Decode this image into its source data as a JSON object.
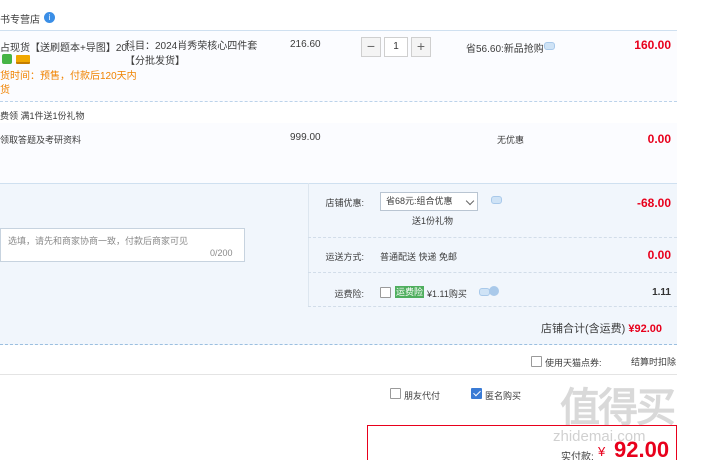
{
  "shop": {
    "name": "书专营店",
    "badge": "i"
  },
  "item1": {
    "title": "占现货【送刷题本+导图】20...",
    "delivery_note": "货时间：预售，付款后120天内",
    "delivery_note2": "货",
    "sku_line1": "科目：2024肖秀荣核心四件套",
    "sku_line2": "【分批发货】",
    "price": "216.60",
    "quantity": "1",
    "minus": "−",
    "plus": "+",
    "save_text": "省56.60:新品抢购",
    "subtotal": "160.00"
  },
  "gift_row": "费领    满1件送1份礼物",
  "item2": {
    "title": "领取答题及考研资料",
    "price": "999.00",
    "discount": "无优惠",
    "subtotal": "0.00"
  },
  "remark": {
    "placeholder": "选填，请先和商家协商一致，付款后商家可见",
    "count": "0/200"
  },
  "summary": {
    "promo_label": "店铺优惠:",
    "promo_value": "省68元:组合优惠",
    "promo_gift": "送1份礼物",
    "promo_amount": "-68.00",
    "shipping_label": "运送方式:",
    "shipping_value": "普通配送 快递 免邮",
    "shipping_amount": "0.00",
    "insurance_label": "运费险:",
    "insurance_badge": "运费险",
    "insurance_value": "¥1.11购买",
    "insurance_amount": "1.11",
    "shop_total_label": "店铺合计(含运费)",
    "shop_total_value": "¥92.00"
  },
  "points": {
    "label": "使用天猫点券:",
    "deduct": "结算时扣除"
  },
  "options": {
    "friend_pay": "朋友代付",
    "anonymous": "匿名购买"
  },
  "payment": {
    "label": "实付款:",
    "currency": "¥",
    "amount": "92.00"
  },
  "watermark": {
    "main": "值得买",
    "url": "zhidemai.com"
  },
  "colors": {
    "accent_red": "#e8001c",
    "orange": "#f08300",
    "blue": "#3a7bd5"
  }
}
